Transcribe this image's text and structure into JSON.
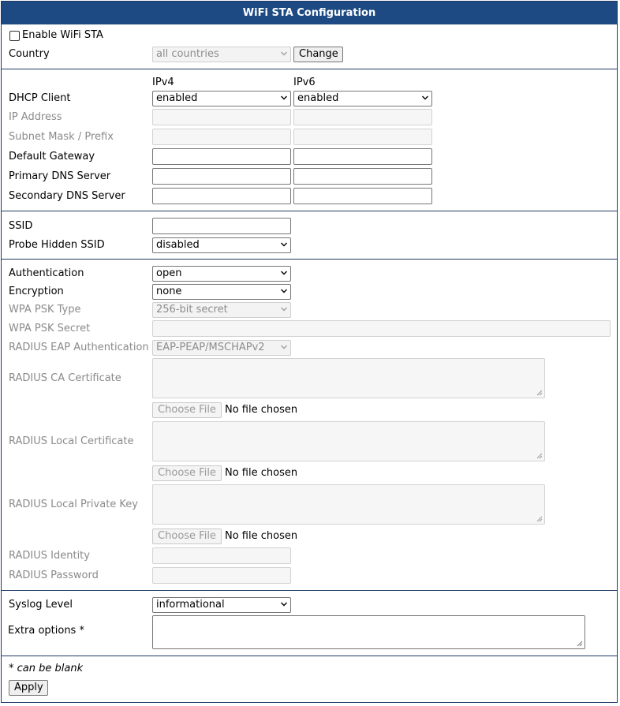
{
  "header": {
    "title": "WiFi STA Configuration"
  },
  "general": {
    "enable_label": "Enable WiFi STA",
    "enable_checked": false,
    "country_label": "Country",
    "country_value": "all countries",
    "change_button": "Change"
  },
  "ip": {
    "ipv4_header": "IPv4",
    "ipv6_header": "IPv6",
    "dhcp_label": "DHCP Client",
    "dhcp_ipv4": "enabled",
    "dhcp_ipv6": "enabled",
    "ip_address_label": "IP Address",
    "subnet_label": "Subnet Mask / Prefix",
    "gateway_label": "Default Gateway",
    "primary_dns_label": "Primary DNS Server",
    "secondary_dns_label": "Secondary DNS Server"
  },
  "ssid": {
    "ssid_label": "SSID",
    "probe_label": "Probe Hidden SSID",
    "probe_value": "disabled"
  },
  "security": {
    "auth_label": "Authentication",
    "auth_value": "open",
    "enc_label": "Encryption",
    "enc_value": "none",
    "psk_type_label": "WPA PSK Type",
    "psk_type_value": "256-bit secret",
    "psk_secret_label": "WPA PSK Secret",
    "eap_label": "RADIUS EAP Authentication",
    "eap_value": "EAP-PEAP/MSCHAPv2",
    "ca_label": "RADIUS CA Certificate",
    "local_cert_label": "RADIUS Local Certificate",
    "private_key_label": "RADIUS Local Private Key",
    "choose_file": "Choose File",
    "no_file": "No file chosen",
    "identity_label": "RADIUS Identity",
    "password_label": "RADIUS Password"
  },
  "misc": {
    "syslog_label": "Syslog Level",
    "syslog_value": "informational",
    "extra_label": "Extra options *"
  },
  "footer": {
    "note": "* can be blank",
    "apply_button": "Apply"
  },
  "colors": {
    "header_bg": "#1d4a82",
    "border": "#1f3a66",
    "disabled_text": "#8a8a8a"
  }
}
